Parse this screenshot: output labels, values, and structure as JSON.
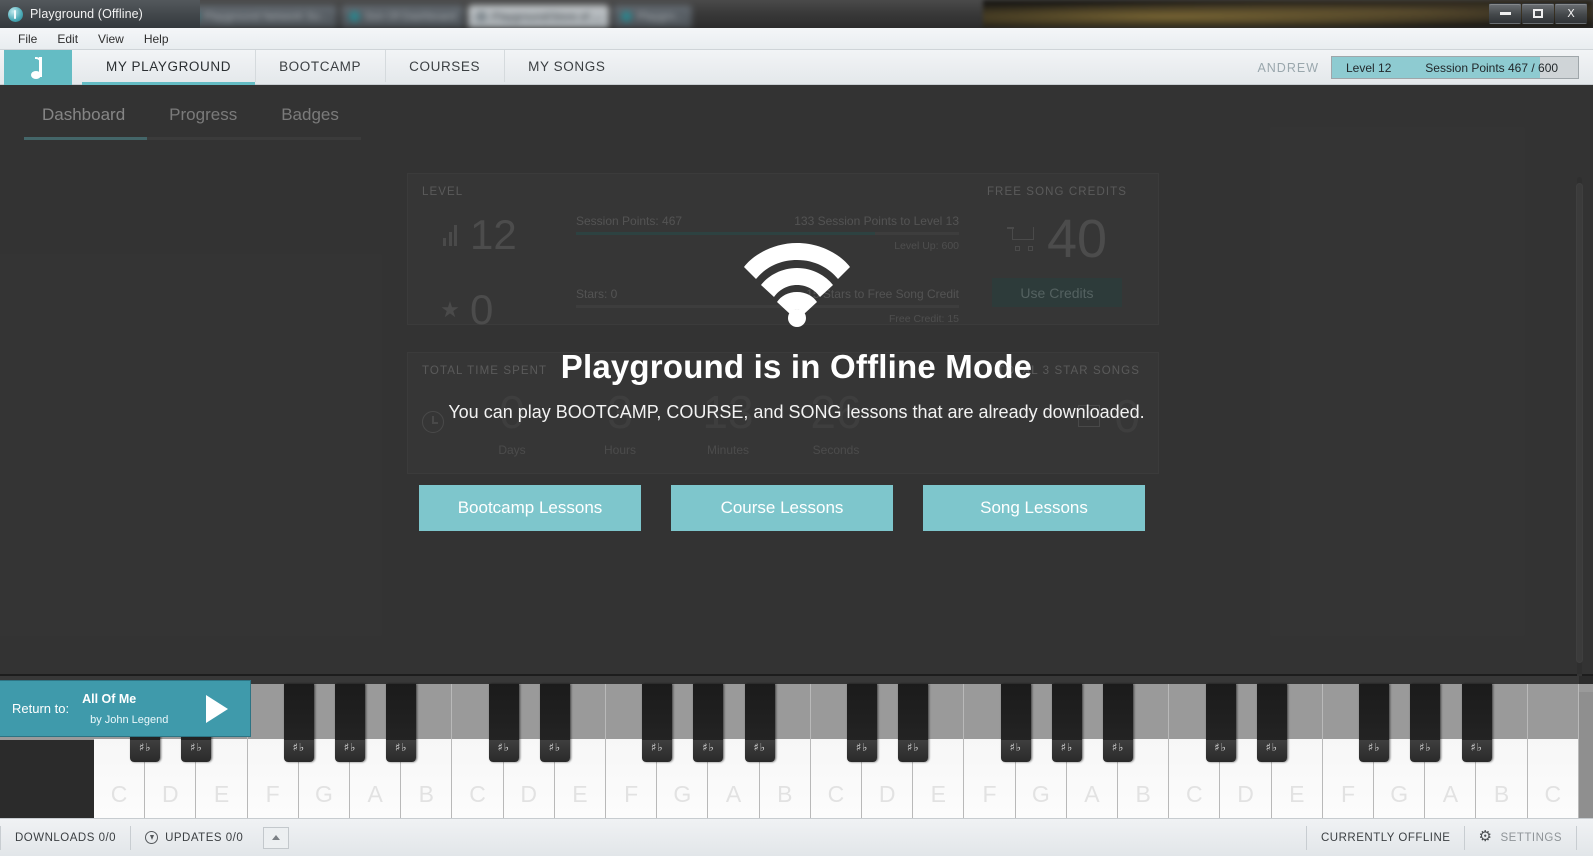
{
  "window": {
    "title": "Playground (Offline)",
    "logo_icon": "playground-logo-icon",
    "minimize_label": "minimize",
    "maximize_label": "maximize",
    "close_label": "X",
    "ghost_tabs": [
      {
        "label": "Playground Network Su..."
      },
      {
        "label": "Son Of Dashboard"
      },
      {
        "label": "Playground/Store of ..."
      },
      {
        "label": "Playgro..."
      }
    ]
  },
  "menubar": {
    "items": [
      "File",
      "Edit",
      "View",
      "Help"
    ]
  },
  "appheader": {
    "primary_nav": [
      {
        "label": "MY PLAYGROUND",
        "active": true
      },
      {
        "label": "BOOTCAMP",
        "active": false
      },
      {
        "label": "COURSES",
        "active": false
      },
      {
        "label": "MY SONGS",
        "active": false
      }
    ],
    "user_name": "ANDREW",
    "level_label": "Level 12",
    "session_points_label": "Session Points 467 / 600",
    "session_points_percent": 78,
    "accent_color": "#64bcc4"
  },
  "subtabs": [
    {
      "label": "Dashboard",
      "active": true
    },
    {
      "label": "Progress",
      "active": false
    },
    {
      "label": "Badges",
      "active": false
    }
  ],
  "level_card": {
    "label": "LEVEL",
    "level_value": "12",
    "level_icon": "bar-chart-icon",
    "stars_value": "0",
    "stars_icon": "star-icon",
    "points_bar": {
      "left_label": "Session Points: 467",
      "right_label": "133 Session Points to Level 13",
      "bottom_label": "Level Up: 600",
      "percent": 78
    },
    "stars_bar": {
      "left_label": "Stars: 0",
      "right_label": "15 Stars to Free Song Credit",
      "bottom_label": "Free Credit: 15",
      "percent": 0
    },
    "credits": {
      "label": "FREE SONG CREDITS",
      "icon": "shopping-cart-icon",
      "value": "40",
      "button_label": "Use Credits"
    }
  },
  "stats_card": {
    "time_label": "TOTAL TIME SPENT",
    "time_icon": "clock-icon",
    "time_units": [
      {
        "value": "0",
        "label": "Days"
      },
      {
        "value": "3",
        "label": "Hours"
      },
      {
        "value": "13",
        "label": "Minutes"
      },
      {
        "value": "26",
        "label": "Seconds"
      }
    ],
    "songs_label": "TOTAL 3 STAR SONGS",
    "songs_icon": "music-note-icon",
    "songs_value": "0"
  },
  "offline_modal": {
    "wifi_icon": "wifi-icon",
    "title": "Playground is in Offline Mode",
    "subtitle": "You can play BOOTCAMP, COURSE, and SONG lessons that are already downloaded.",
    "buttons": [
      {
        "label": "Bootcamp Lessons"
      },
      {
        "label": "Course Lessons"
      },
      {
        "label": "Song Lessons"
      }
    ],
    "button_color": "#7ec6cc"
  },
  "now_playing": {
    "return_label": "Return to:",
    "song_title": "All Of Me",
    "song_artist": "by John Legend",
    "play_icon": "play-triangle-icon",
    "bar_color": "#3f9aab"
  },
  "piano": {
    "white_key_labels": [
      "C",
      "D",
      "E",
      "F",
      "G",
      "A",
      "B",
      "C",
      "D",
      "E",
      "F",
      "G",
      "A",
      "B",
      "C",
      "D",
      "E",
      "F",
      "G",
      "A",
      "B",
      "C",
      "D",
      "E",
      "F",
      "G",
      "A",
      "B",
      "C"
    ],
    "black_key_symbol": "♯♭",
    "black_key_pattern": [
      0,
      1,
      3,
      4,
      5
    ]
  },
  "statusbar": {
    "downloads_label": "DOWNLOADS 0/0",
    "updates_icon": "download-circle-icon",
    "updates_label": "UPDATES 0/0",
    "expand_icon": "caret-up-icon",
    "offline_label": "CURRENTLY OFFLINE",
    "settings_icon": "gear-icon",
    "settings_label": "SETTINGS"
  }
}
